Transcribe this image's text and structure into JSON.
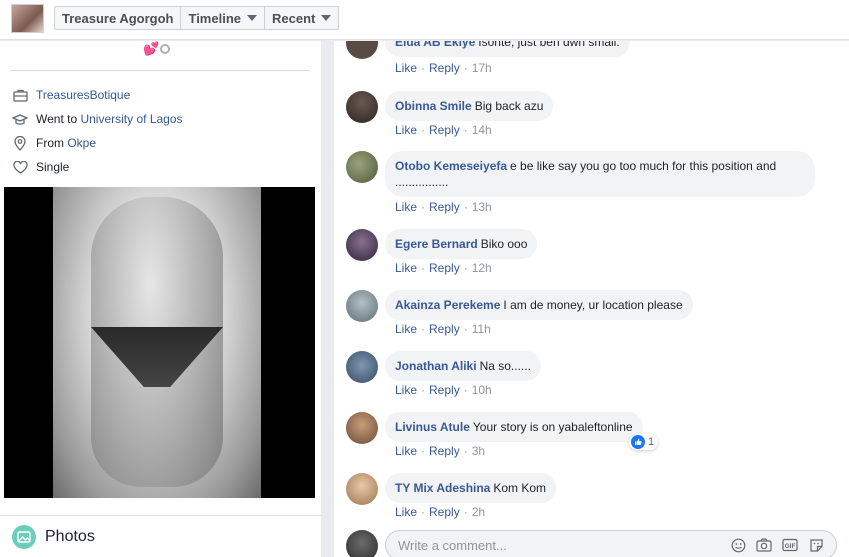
{
  "header": {
    "profile_name": "Treasure Agorgoh",
    "timeline_label": "Timeline",
    "recent_label": "Recent"
  },
  "intro": {
    "emoji": "💕",
    "work": "TreasuresBotique",
    "education_prefix": "Went to ",
    "education": "University of Lagos",
    "from_prefix": "From ",
    "hometown": "Okpe",
    "relationship": "Single"
  },
  "photos": {
    "label": "Photos"
  },
  "comments": [
    {
      "name": "Eida AB Ekiye",
      "text": "Isonte, just ben dwn small.",
      "like": "Like",
      "reply": "Reply",
      "time": "17h",
      "avatar_color": "#5a4a44"
    },
    {
      "name": "Obinna Smile",
      "text": "Big back azu",
      "like": "Like",
      "reply": "Reply",
      "time": "14h",
      "avatar_color": "#3d3431"
    },
    {
      "name": "Otobo Kemeseiyefa",
      "text": "e be like say you go too much for this position and ................",
      "like": "Like",
      "reply": "Reply",
      "time": "13h",
      "avatar_color": "#6e7a5a"
    },
    {
      "name": "Egere Bernard",
      "text": "Biko ooo",
      "like": "Like",
      "reply": "Reply",
      "time": "12h",
      "avatar_color": "#4a3b5c"
    },
    {
      "name": "Akainza Perekeme",
      "text": "I am de money, ur location please",
      "like": "Like",
      "reply": "Reply",
      "time": "11h",
      "avatar_color": "#7c8c95"
    },
    {
      "name": "Jonathan Aliki",
      "text": "Na so......",
      "like": "Like",
      "reply": "Reply",
      "time": "10h",
      "avatar_color": "#536c86"
    },
    {
      "name": "Livinus Atule",
      "text": "Your story is on yabaleftonline",
      "like": "Like",
      "reply": "Reply",
      "time": "3h",
      "avatar_color": "#8a6a52",
      "reactions": "1"
    },
    {
      "name": "TY Mix Adeshina",
      "text": "Kom Kom",
      "like": "Like",
      "reply": "Reply",
      "time": "2h",
      "avatar_color": "#b08968"
    }
  ],
  "composer": {
    "placeholder": "Write a comment..."
  },
  "colors": {
    "link": "#385898",
    "bubble": "#f2f3f5",
    "like_blue": "#1877f2"
  }
}
